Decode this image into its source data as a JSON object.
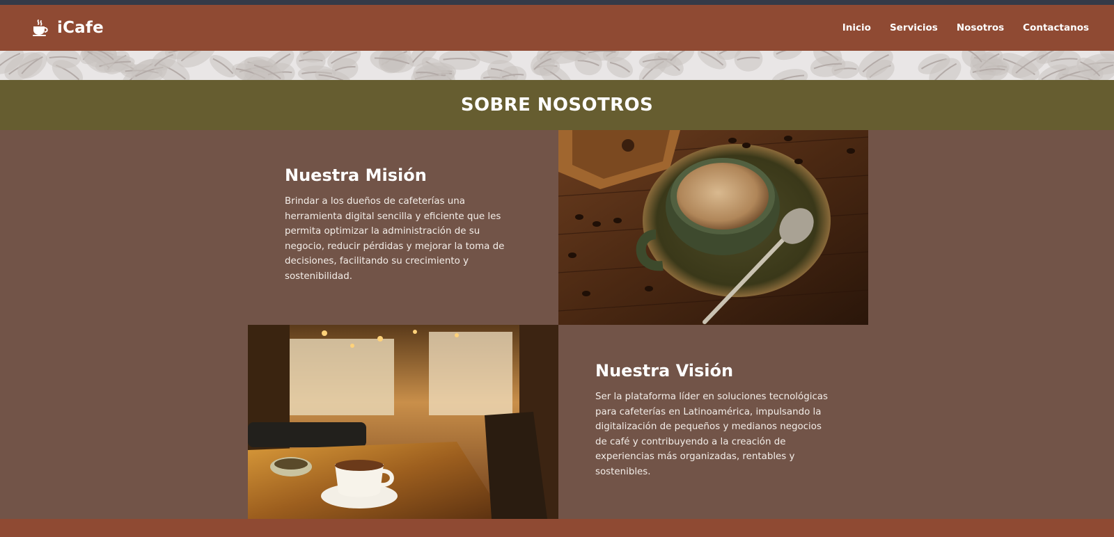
{
  "brand": {
    "name": "iCafe",
    "icon": "coffee-cup-icon"
  },
  "nav": {
    "items": [
      "Inicio",
      "Servicios",
      "Nosotros",
      "Contactanos"
    ]
  },
  "about": {
    "title": "SOBRE NOSOTROS"
  },
  "mission": {
    "title": "Nuestra Misión",
    "lines": [
      "Brindar a los dueños de cafeterías una",
      "herramienta digital sencilla y eficiente que les",
      "permita optimizar la administración de su",
      "negocio, reducir pérdidas y mejorar la toma de",
      "decisiones, facilitando su crecimiento y",
      "sostenibilidad."
    ]
  },
  "vision": {
    "title": "Nuestra Visión",
    "lines": [
      "Ser la plataforma líder en soluciones tecnológicas",
      "para cafeterías en Latinoamérica, impulsando la",
      "digitalización de pequeños y medianos negocios",
      "de café y contribuyendo a la creación de",
      "experiencias más organizadas, rentables y",
      "sostenibles."
    ]
  },
  "colors": {
    "navbar": "#8f4a33",
    "top_strip": "#343a48",
    "title_bar": "#665d30",
    "content_bg": "#725448"
  }
}
